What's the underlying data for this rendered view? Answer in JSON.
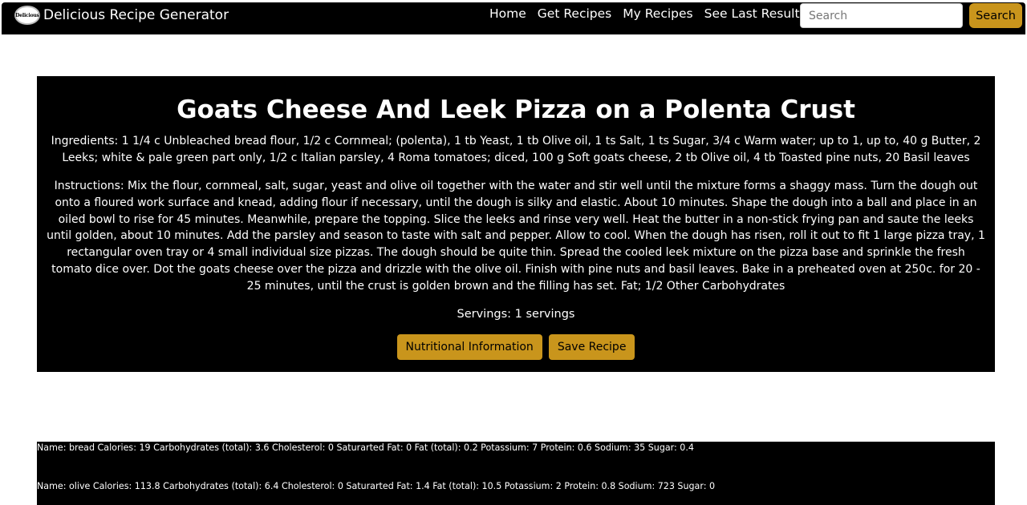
{
  "header": {
    "logo_text": "Delicious",
    "app_title": "Delicious Recipe Generator",
    "nav": [
      "Home",
      "Get Recipes",
      "My Recipes",
      "See Last Results"
    ],
    "search_placeholder": "Search",
    "search_button": "Search"
  },
  "recipe": {
    "title": "Goats Cheese And Leek Pizza on a Polenta Crust",
    "ingredients": "Ingredients: 1 1/4 c Unbleached bread flour, 1/2 c Cornmeal; (polenta), 1 tb Yeast, 1 tb Olive oil, 1 ts Salt, 1 ts Sugar, 3/4 c Warm water; up to 1, up to, 40 g Butter, 2 Leeks; white & pale green part only, 1/2 c Italian parsley, 4 Roma tomatoes; diced, 100 g Soft goats cheese, 2 tb Olive oil, 4 tb Toasted pine nuts, 20 Basil leaves",
    "instructions": "Instructions: Mix the flour, cornmeal, salt, sugar, yeast and olive oil together with the water and stir well until the mixture forms a shaggy mass. Turn the dough out onto a floured work surface and knead, adding flour if necessary, until the dough is silky and elastic. About 10 minutes. Shape the dough into a ball and place in an oiled bowl to rise for 45 minutes. Meanwhile, prepare the topping. Slice the leeks and rinse very well. Heat the butter in a non-stick frying pan and saute the leeks until golden, about 10 minutes. Add the parsley and season to taste with salt and pepper. Allow to cool. When the dough has risen, roll it out to fit 1 large pizza tray, 1 rectangular oven tray or 4 small individual size pizzas. The dough should be quite thin. Spread the cooled leek mixture on the pizza base and sprinkle the fresh tomato dice over. Dot the goats cheese over the pizza and drizzle with the olive oil. Finish with pine nuts and basil leaves. Bake in a preheated oven at 250c. for 20 - 25 minutes, until the crust is golden brown and the filling has set. Fat; 1/2 Other Carbohydrates",
    "servings": "Servings: 1 servings",
    "nutrition_button": "Nutritional Information",
    "save_button": "Save Recipe"
  },
  "nutrition": [
    "Name: bread  Calories: 19  Carbohydrates (total): 3.6  Cholesterol: 0  Saturarted Fat: 0  Fat (total): 0.2  Potassium: 7  Protein: 0.6  Sodium: 35  Sugar: 0.4",
    "Name: olive  Calories: 113.8  Carbohydrates (total): 6.4  Cholesterol: 0  Saturarted Fat: 1.4  Fat (total): 10.5  Potassium: 2  Protein: 0.8  Sodium: 723  Sugar: 0"
  ],
  "colors": {
    "accent": "#c9951c",
    "background": "#000000",
    "text": "#ffffff"
  }
}
